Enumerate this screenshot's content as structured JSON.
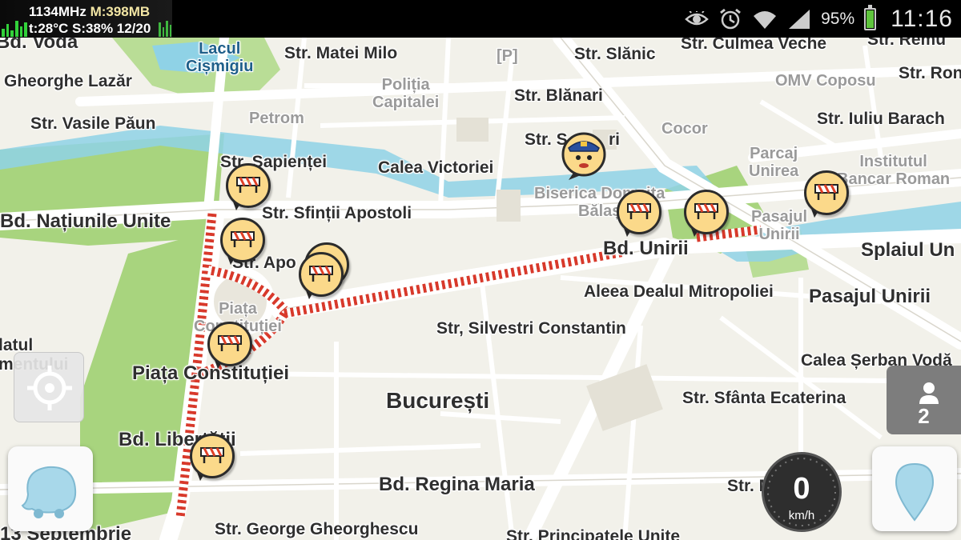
{
  "status_bar": {
    "cpu_freq": "1134MHz",
    "memory": "M:398MB",
    "temp_line": "t:28°C S:38% 12/20",
    "battery_pct": "95%",
    "battery_level": 0.95,
    "time": "11:16",
    "icons": [
      "eye-icon",
      "alarm-icon",
      "wifi-icon",
      "signal-icon",
      "battery-icon"
    ]
  },
  "map": {
    "labels": {
      "bd_voda": "Bd. Vodă",
      "lacul": "Lacul\nCișmigiu",
      "matei_milo": "Str. Matei Milo",
      "parking": "[P]",
      "slanic": "Str. Slănic",
      "culmea": "Str. Culmea Veche",
      "remus": "Str. Remu",
      "gheorghe": "Gheorghe Lazăr",
      "politia": "Poliția\nCapitalei",
      "blanari": "Str. Blănari",
      "omv": "OMV Coposu",
      "str_ron": "Str. Ron",
      "vasile": "Str. Vasile Păun",
      "petrom": "Petrom",
      "cocor": "Cocor",
      "iuliu": "Str. Iuliu Barach",
      "str_s": "Str. S",
      "ri": "ri",
      "parcaj": "Parcaj\nUnirea",
      "institutul": "Institutul\nBancar Roman",
      "sapientiei": "Str. Sapienței",
      "calea_victoriei": "Calea Victoriei",
      "biserica": "Biserica Domnița\nBălaș",
      "natiunile": "Bd. Națiunile Unite",
      "sfintii": "Str. Sfinții Apostoli",
      "pasajul_unirii_small": "Pasajul\nUnirii",
      "bd_unirii": "Bd. Unirii",
      "splaiul": "Splaiul Un",
      "str_apo": "Str. Apo",
      "aleea": "Aleea Dealul Mitropoliei",
      "pasajul_unirii": "Pasajul Unirii",
      "piata": "Piața\nConstituției",
      "silvestri": "Str, Silvestri Constantin",
      "latul": "latul\nmentului",
      "calea_serban": "Calea Șerban Vodă",
      "piata_constitutiei": "Piața Constituției",
      "bucuresti": "București",
      "sfanta": "Str. Sfânta Ecaterina",
      "bd_libertatii": "Bd. Libertății",
      "regina": "Bd. Regina Maria",
      "str_mu": "Str. Mu",
      "septembrie": "13 Septembrie",
      "gheorghescu": "Str. George Gheorghescu",
      "principatele": "Str. Principatele Unite"
    }
  },
  "controls": {
    "users_count": "2",
    "speed_value": "0",
    "speed_unit": "km/h"
  }
}
